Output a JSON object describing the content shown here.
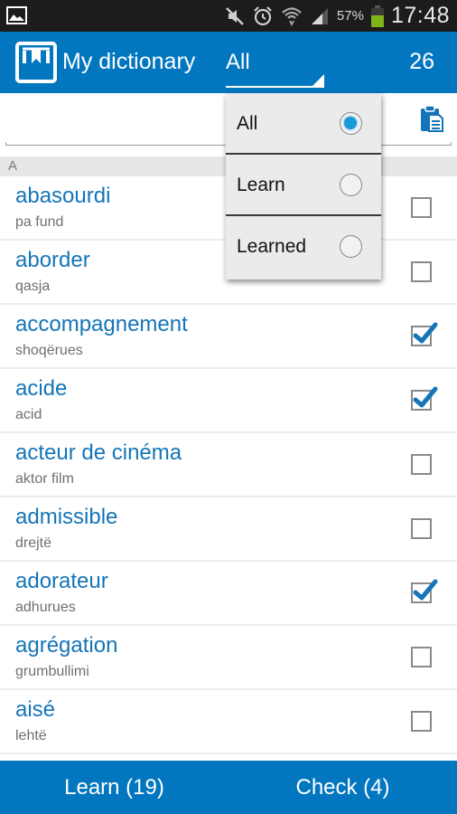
{
  "status_bar": {
    "left_icon": "gallery-notification-icon",
    "icons": [
      "mute-icon",
      "alarm-icon",
      "wifi-icon",
      "signal-icon",
      "battery-icon"
    ],
    "battery_percent": "57%",
    "time": "17:48"
  },
  "action_bar": {
    "logo_icon": "bookmark-book-icon",
    "title": "My dictionary",
    "filter_value": "All",
    "count": "26"
  },
  "search": {
    "value": "",
    "placeholder": "",
    "paste_icon": "clipboard-icon"
  },
  "section_header": "A",
  "words": [
    {
      "word": "abasourdi",
      "translation": "pa fund",
      "checked": false
    },
    {
      "word": "aborder",
      "translation": "qasja",
      "checked": false
    },
    {
      "word": "accompagnement",
      "translation": "shoqërues",
      "checked": true
    },
    {
      "word": "acide",
      "translation": "acid",
      "checked": true
    },
    {
      "word": "acteur de cinéma",
      "translation": "aktor film",
      "checked": false
    },
    {
      "word": "admissible",
      "translation": "drejtë",
      "checked": false
    },
    {
      "word": "adorateur",
      "translation": "adhurues",
      "checked": true
    },
    {
      "word": "agrégation",
      "translation": "grumbullimi",
      "checked": false
    },
    {
      "word": "aisé",
      "translation": "lehtë",
      "checked": false
    }
  ],
  "filter_dropdown": {
    "options": [
      {
        "label": "All",
        "selected": true
      },
      {
        "label": "Learn",
        "selected": false
      },
      {
        "label": "Learned",
        "selected": false
      }
    ]
  },
  "bottom_bar": {
    "learn_label": "Learn (19)",
    "check_label": "Check (4)"
  },
  "colors": {
    "primary": "#0277bf",
    "word_text": "#1575b8",
    "radio_selected": "#1a9ad8"
  }
}
